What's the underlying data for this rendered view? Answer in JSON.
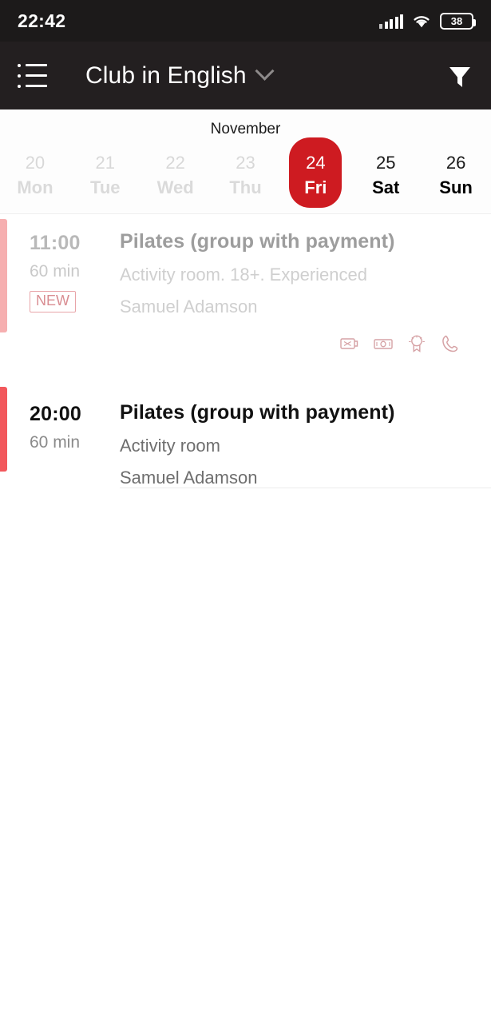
{
  "status_bar": {
    "time": "22:42",
    "battery_level": "38",
    "signal_icon": "signal-bars-icon",
    "wifi_icon": "wifi-icon",
    "battery_icon": "battery-icon"
  },
  "app_bar": {
    "menu_icon": "list-menu-icon",
    "title": "Club in English",
    "dropdown_icon": "chevron-down-icon",
    "filter_icon": "filter-funnel-icon"
  },
  "date_strip": {
    "month": "November",
    "days": [
      {
        "num": "20",
        "dow": "Mon",
        "state": "past"
      },
      {
        "num": "21",
        "dow": "Tue",
        "state": "past"
      },
      {
        "num": "22",
        "dow": "Wed",
        "state": "past"
      },
      {
        "num": "23",
        "dow": "Thu",
        "state": "past"
      },
      {
        "num": "24",
        "dow": "Fri",
        "state": "selected"
      },
      {
        "num": "25",
        "dow": "Sat",
        "state": "normal"
      },
      {
        "num": "26",
        "dow": "Sun",
        "state": "normal"
      }
    ]
  },
  "events": [
    {
      "time": "11:00",
      "duration": "60 min",
      "badge": "NEW",
      "title": "Pilates (group with payment)",
      "subtitle": "Activity room. 18+. Experienced",
      "coach": "Samuel Adamson",
      "state": "faded",
      "accent_color": "#f6afb0",
      "icons": [
        "no-card-payment-icon",
        "cash-payment-icon",
        "award-ribbon-icon",
        "phone-call-icon"
      ]
    },
    {
      "time": "20:00",
      "duration": "60 min",
      "badge": "",
      "title": "Pilates (group with payment)",
      "subtitle": "Activity room",
      "coach": "Samuel Adamson",
      "state": "active",
      "accent_color": "#f2585c",
      "icons": []
    }
  ],
  "colors": {
    "accent_red": "#ce1b21",
    "accent_red_light": "#f6afb0",
    "accent_red_bar": "#f2585c",
    "statusbar_bg": "#1c1a1a",
    "appbar_bg": "#231f20",
    "badge_border": "#e8a4a8"
  }
}
